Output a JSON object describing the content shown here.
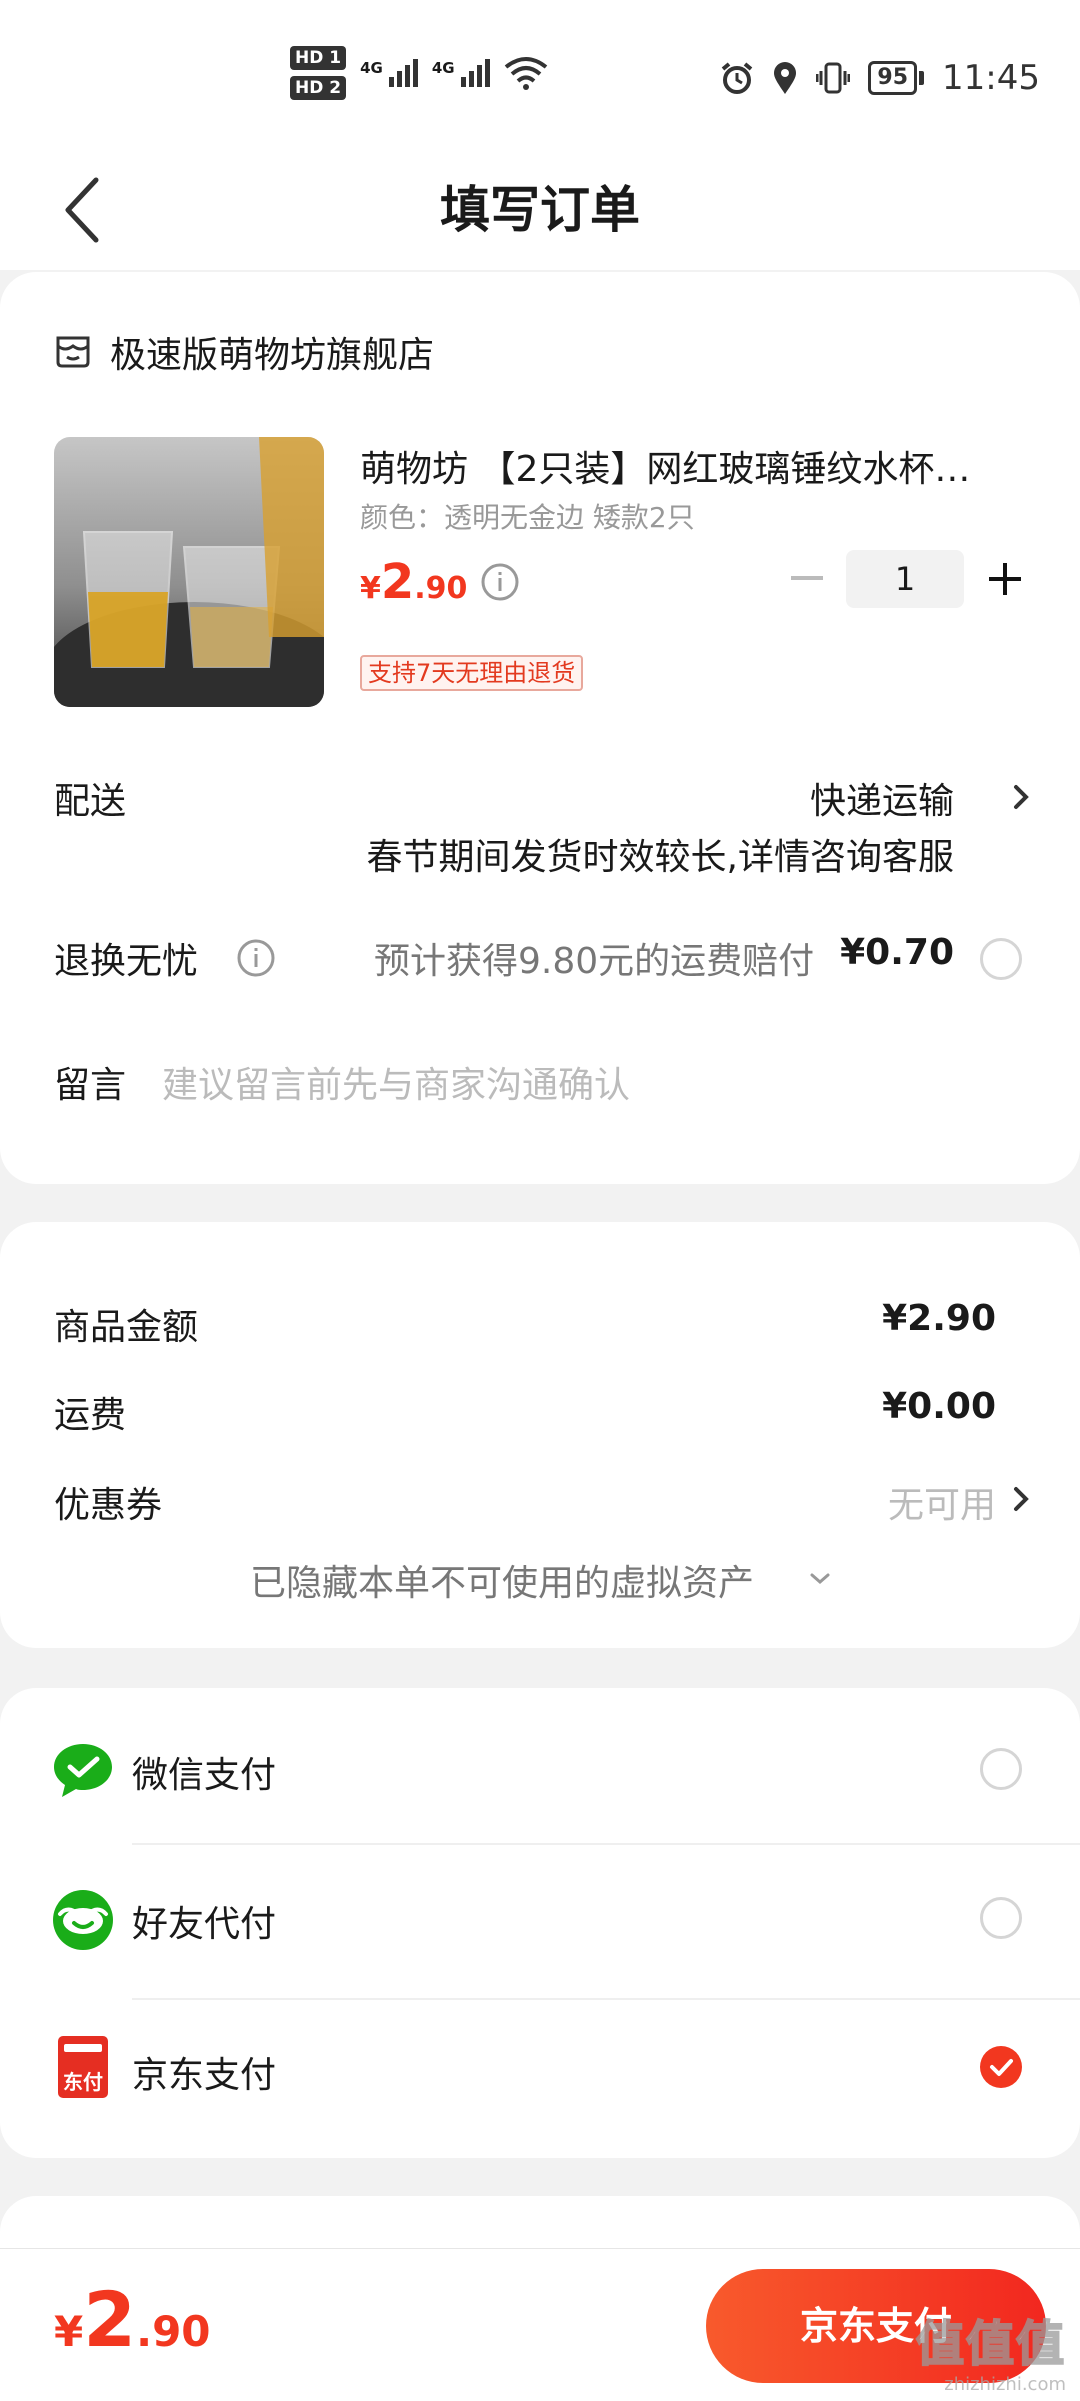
{
  "status_bar": {
    "hd1": "HD 1",
    "hd2": "HD 2",
    "net1": "4G",
    "net2": "4G",
    "battery": "95",
    "time": "11:45"
  },
  "header": {
    "title": "填写订单"
  },
  "store": {
    "name": "极速版萌物坊旗舰店",
    "product_title": "萌物坊 【2只装】网红玻璃锤纹水杯…",
    "product_spec": "颜色：透明无金边 矮款2只",
    "price_symbol": "¥",
    "price_int": "2",
    "price_dec": ".90",
    "quantity": "1",
    "return_tag": "支持7天无理由退货"
  },
  "delivery": {
    "label": "配送",
    "method": "快递运输",
    "note": "春节期间发货时效较长,详情咨询客服"
  },
  "worry_free": {
    "label": "退换无忧",
    "desc": "预计获得9.80元的运费赔付",
    "price": "¥0.70",
    "checked": false
  },
  "message": {
    "label": "留言",
    "placeholder": "建议留言前先与商家沟通确认"
  },
  "summary": {
    "goods_label": "商品金额",
    "goods_value": "¥2.90",
    "freight_label": "运费",
    "freight_value": "¥0.00",
    "coupon_label": "优惠券",
    "coupon_value": "无可用",
    "hidden_note": "已隐藏本单不可使用的虚拟资产"
  },
  "payment": {
    "methods": [
      {
        "label": "微信支付",
        "icon": "wechat-pay-icon",
        "checked": false
      },
      {
        "label": "好友代付",
        "icon": "friend-pay-icon",
        "checked": false
      },
      {
        "label": "京东支付",
        "icon": "jd-pay-icon",
        "checked": true
      }
    ],
    "jd_icon_text": "东付"
  },
  "footer": {
    "price_symbol": "¥",
    "price_int": "2",
    "price_dec": ".90",
    "pay_button": "京东支付"
  },
  "watermark": {
    "main": "值值值",
    "sub": "zhizhizhi.com"
  },
  "colors": {
    "accent": "#f2371f",
    "wechat": "#1aad19",
    "page_bg": "#f2f2f2"
  }
}
